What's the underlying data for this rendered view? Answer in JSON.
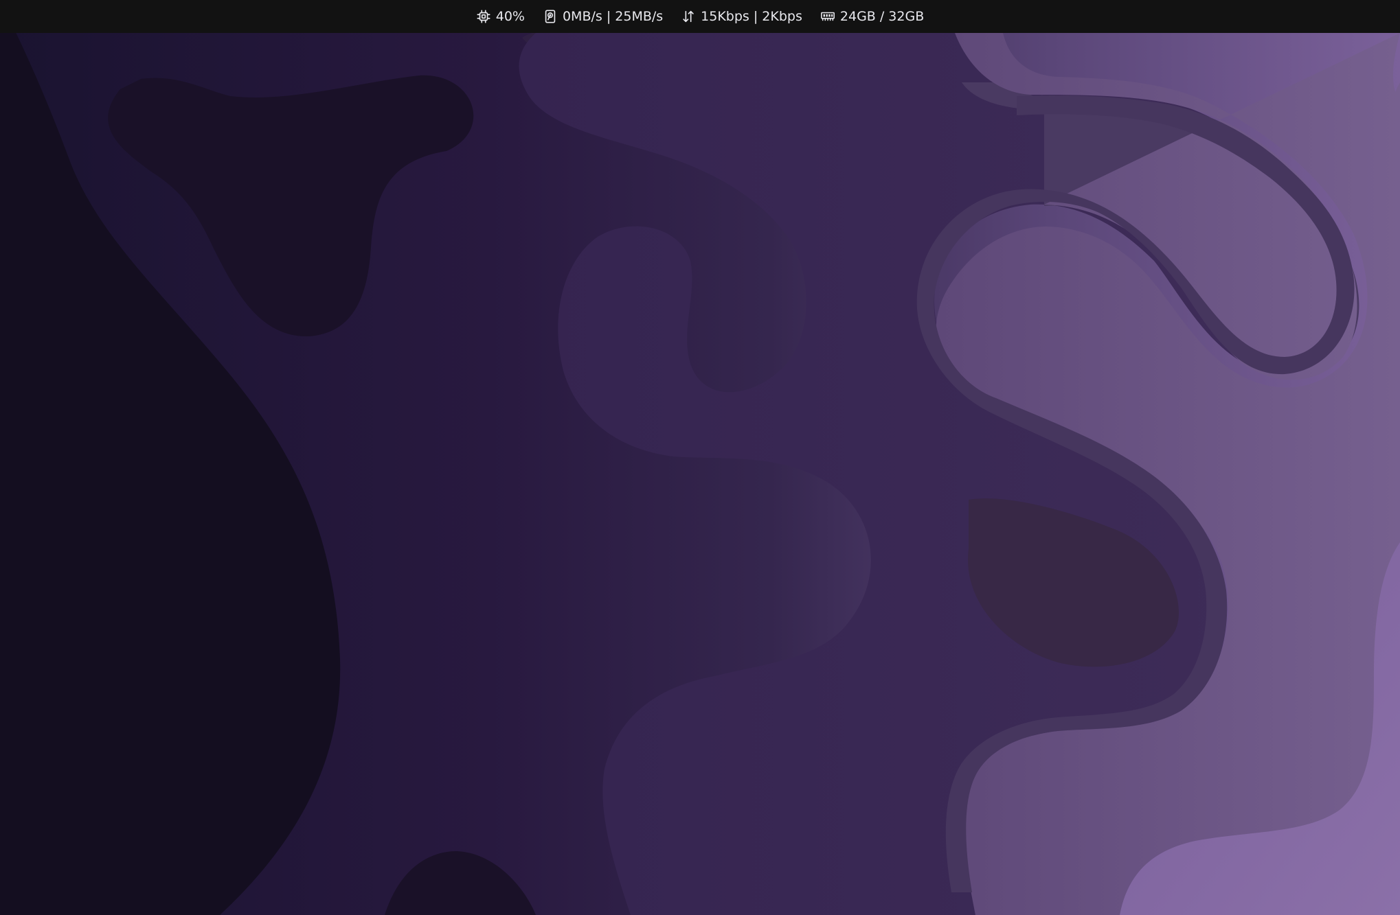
{
  "status_bar": {
    "cpu": {
      "icon": "cpu-icon",
      "value": "40%"
    },
    "disk": {
      "icon": "hard-drive-icon",
      "value": "0MB/s | 25MB/s"
    },
    "network": {
      "icon": "up-down-arrows-icon",
      "value": "15Kbps | 2Kbps"
    },
    "memory": {
      "icon": "memory-module-icon",
      "value": "24GB / 32GB"
    }
  },
  "wallpaper": {
    "colors": {
      "darkest": "#140e20",
      "dark": "#21173a",
      "mid_dark": "#2c1e44",
      "mid": "#3a2a56",
      "mid_light": "#4a3a62",
      "light": "#6a5488",
      "lightest": "#846aa4",
      "blob_dark": "#1a1128",
      "blob_mid": "#2f2042",
      "blob_rose": "#382846"
    }
  }
}
